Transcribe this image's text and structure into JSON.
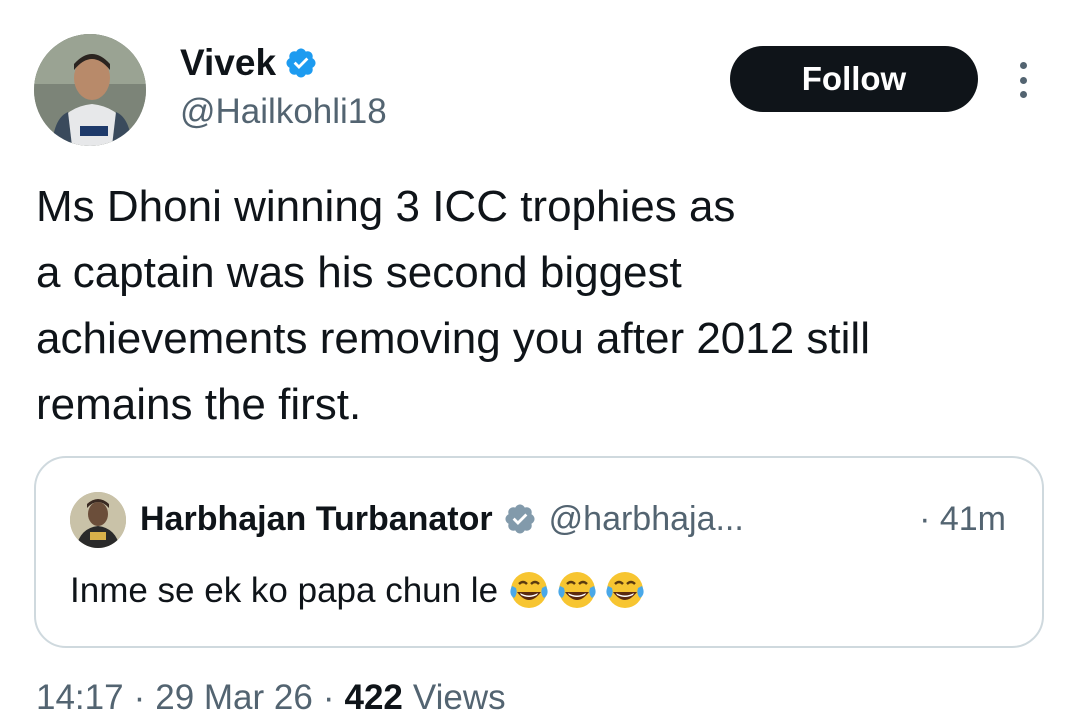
{
  "author": {
    "display_name": "Vivek",
    "handle": "@Hailkohli18",
    "verified": true,
    "avatar_icon": "profile-photo"
  },
  "actions": {
    "follow_label": "Follow",
    "more_icon": "more-vertical-icon"
  },
  "tweet": {
    "text": "Ms Dhoni winning 3 ICC trophies as\na captain was his second biggest\nachievements removing you after 2012 still\nremains the first."
  },
  "quote": {
    "display_name": "Harbhajan Turbanator",
    "handle": "@harbhaja...",
    "verified": true,
    "time": "· 41m",
    "text": "Inme se ek ko papa chun le",
    "emoji": [
      "face-with-tears-of-joy",
      "face-with-tears-of-joy",
      "face-with-tears-of-joy"
    ]
  },
  "meta": {
    "time": "14:17",
    "date": "29 Mar 26",
    "separator": "·",
    "views_count": "422",
    "views_label": "Views"
  },
  "colors": {
    "text_primary": "#0f1419",
    "text_secondary": "#536471",
    "verified_blue": "#1d9bf0",
    "border": "#cfd9de",
    "follow_bg": "#0f1419"
  }
}
